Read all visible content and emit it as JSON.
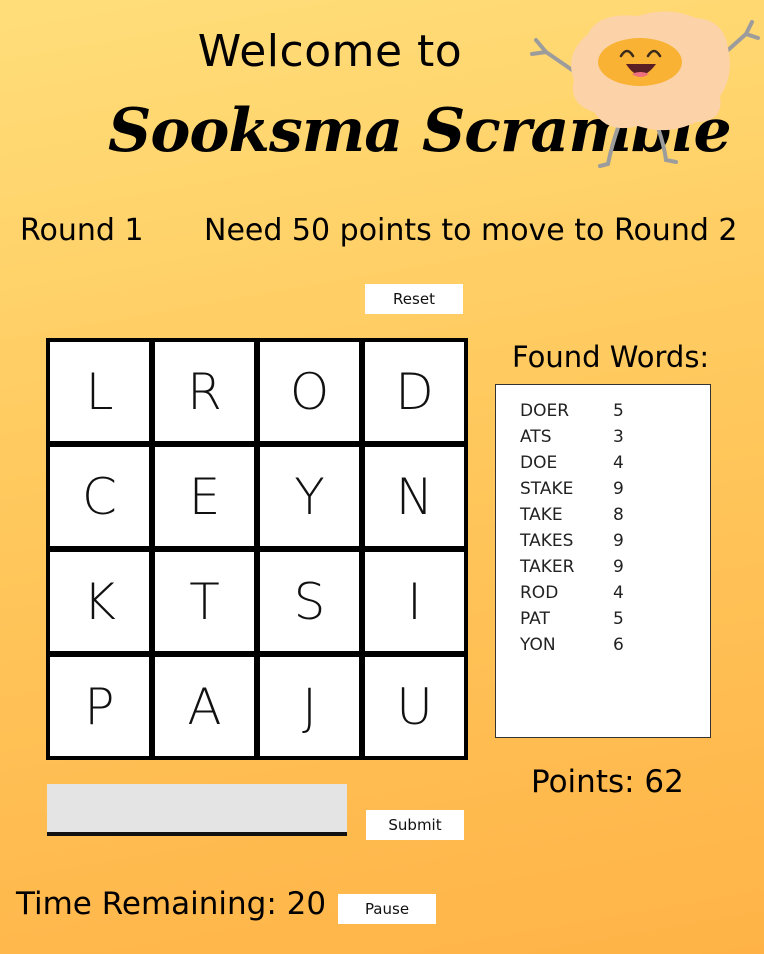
{
  "header": {
    "welcome": "Welcome to",
    "title": "Sooksma Scramble"
  },
  "round": {
    "label": "Round 1",
    "requirement": "Need 50 points to move to Round 2"
  },
  "buttons": {
    "reset": "Reset",
    "submit": "Submit",
    "pause": "Pause"
  },
  "board": {
    "tiles": [
      "L",
      "R",
      "O",
      "D",
      "C",
      "E",
      "Y",
      "N",
      "K",
      "T",
      "S",
      "I",
      "P",
      "A",
      "J",
      "U"
    ]
  },
  "found_words": {
    "heading": "Found Words:",
    "items": [
      {
        "word": "DOER",
        "points": "5"
      },
      {
        "word": "ATS",
        "points": "3"
      },
      {
        "word": "DOE",
        "points": "4"
      },
      {
        "word": "STAKE",
        "points": "9"
      },
      {
        "word": "TAKE",
        "points": "8"
      },
      {
        "word": "TAKES",
        "points": "9"
      },
      {
        "word": "TAKER",
        "points": "9"
      },
      {
        "word": "ROD",
        "points": "4"
      },
      {
        "word": "PAT",
        "points": "5"
      },
      {
        "word": "YON",
        "points": "6"
      }
    ]
  },
  "score": {
    "points_text": "Points: 62"
  },
  "input": {
    "value": "",
    "placeholder": ""
  },
  "timer": {
    "text": "Time Remaining: 20"
  },
  "mascot": {
    "icon": "egg-mascot-icon"
  },
  "colors": {
    "bg_top": "#ffde7a",
    "bg_bottom": "#ffb347",
    "egg_white": "#fcd2a8",
    "yolk": "#f9b233"
  }
}
